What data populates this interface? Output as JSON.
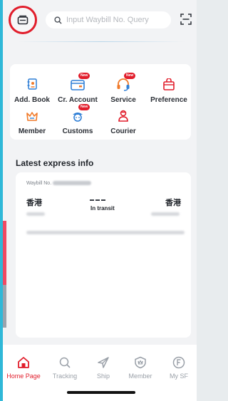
{
  "search": {
    "placeholder": "Input Waybill No. Query"
  },
  "menu": {
    "items": [
      {
        "label": "Add. Book",
        "icon": "address-book-icon"
      },
      {
        "label": "Cr. Account",
        "icon": "credit-account-icon",
        "badge": "New"
      },
      {
        "label": "Service",
        "icon": "service-headset-icon",
        "badge": "New"
      },
      {
        "label": "Preference",
        "icon": "preference-bag-icon"
      },
      {
        "label": "Member",
        "icon": "member-crown-icon"
      },
      {
        "label": "Customs",
        "icon": "customs-officer-icon",
        "badge": "New"
      },
      {
        "label": "Courier",
        "icon": "courier-person-icon"
      }
    ]
  },
  "latest": {
    "title": "Latest express info",
    "waybill_label": "Waybill No.",
    "from_city": "香港",
    "to_city": "香港",
    "status": "In transit"
  },
  "bottom_nav": {
    "items": [
      {
        "label": "Home Page",
        "icon": "home-icon",
        "active": true
      },
      {
        "label": "Tracking",
        "icon": "search-icon"
      },
      {
        "label": "Ship",
        "icon": "paper-plane-icon"
      },
      {
        "label": "Member",
        "icon": "member-shield-icon"
      },
      {
        "label": "My SF",
        "icon": "my-sf-icon"
      }
    ]
  },
  "colors": {
    "brand_red": "#e11d2b",
    "accent_orange": "#f07a2a",
    "accent_blue": "#2f7fd6"
  }
}
